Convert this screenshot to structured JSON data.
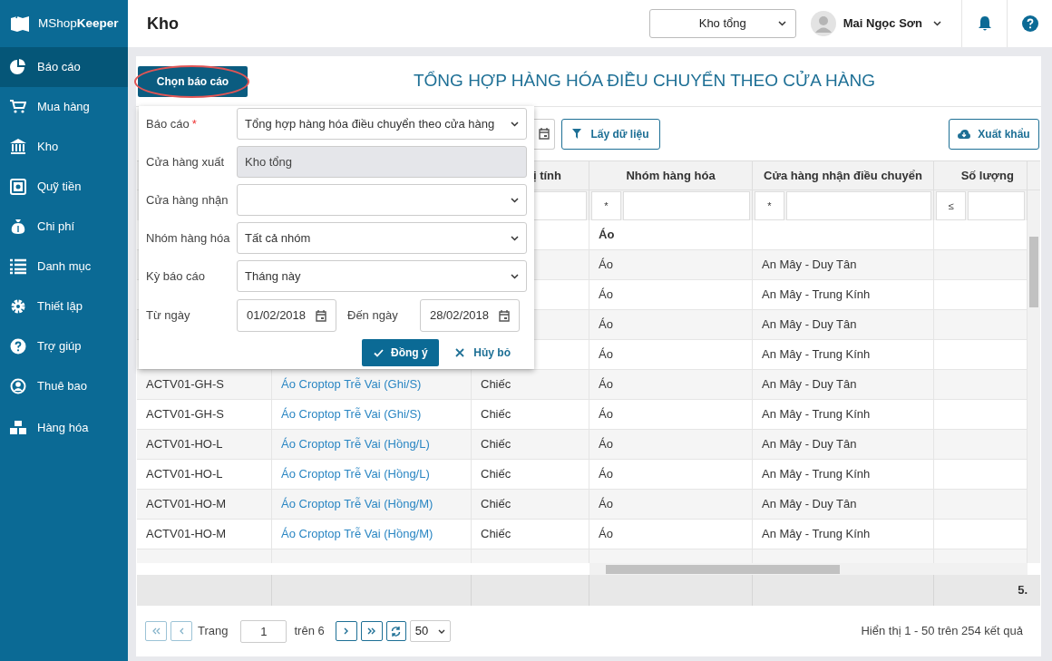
{
  "app": {
    "logo": "MShop**Keeper**"
  },
  "sidebar": {
    "items": [
      {
        "label": "Báo cáo",
        "selected": true
      },
      {
        "label": "Mua hàng",
        "selected": false
      },
      {
        "label": "Kho",
        "selected": false
      },
      {
        "label": "Quỹ tiền",
        "selected": false
      },
      {
        "label": "Chi phí",
        "selected": false
      },
      {
        "label": "Danh mục",
        "selected": false
      },
      {
        "label": "Thiết lập",
        "selected": false
      },
      {
        "label": "Trợ giúp",
        "selected": false
      },
      {
        "label": "Thuê bao",
        "selected": false
      },
      {
        "label": "Hàng hóa",
        "selected": false
      }
    ]
  },
  "header": {
    "title": "Kho",
    "store_select": "Kho tổng",
    "user": "Mai Ngọc Sơn"
  },
  "report": {
    "choose_button": "Chọn báo cáo",
    "choose_highlighted": true,
    "title": "TỔNG HỢP HÀNG HÓA ĐIỀU CHUYỂN THEO CỬA HÀNG"
  },
  "toolbar": {
    "fetch_button": "Lấy dữ liệu",
    "export_button": "Xuất khẩu"
  },
  "table": {
    "columns": [
      {},
      {},
      {
        "label": "ị tính"
      },
      {
        "label": "Nhóm hàng hóa",
        "filter_op": "*"
      },
      {
        "label": "Cửa hàng nhận điều chuyển",
        "filter_op": "*"
      },
      {
        "label": "Số lượng",
        "filter_op": "≤"
      }
    ],
    "rows": [
      {
        "kind": "group",
        "group": "Áo"
      },
      {
        "kind": "item",
        "group": "Áo",
        "store": "An Mây - Duy Tân"
      },
      {
        "kind": "item",
        "group": "Áo",
        "store": "An Mây - Trung Kính"
      },
      {
        "kind": "item",
        "group": "Áo",
        "store": "An Mây - Duy Tân"
      },
      {
        "kind": "item",
        "group": "Áo",
        "store": "An Mây - Trung Kính"
      },
      {
        "kind": "item",
        "code": "ACTV01-GH-S",
        "name": "Áo Croptop Trễ Vai (Ghi/S)",
        "unit": "Chiếc",
        "group": "Áo",
        "store": "An Mây - Duy Tân"
      },
      {
        "kind": "item",
        "code": "ACTV01-GH-S",
        "name": "Áo Croptop Trễ Vai (Ghi/S)",
        "unit": "Chiếc",
        "group": "Áo",
        "store": "An Mây - Trung Kính"
      },
      {
        "kind": "item",
        "code": "ACTV01-HO-L",
        "name": "Áo Croptop Trễ Vai (Hồng/L)",
        "unit": "Chiếc",
        "group": "Áo",
        "store": "An Mây - Duy Tân"
      },
      {
        "kind": "item",
        "code": "ACTV01-HO-L",
        "name": "Áo Croptop Trễ Vai (Hồng/L)",
        "unit": "Chiếc",
        "group": "Áo",
        "store": "An Mây - Trung Kính"
      },
      {
        "kind": "item",
        "code": "ACTV01-HO-M",
        "name": "Áo Croptop Trễ Vai (Hồng/M)",
        "unit": "Chiếc",
        "group": "Áo",
        "store": "An Mây - Duy Tân"
      },
      {
        "kind": "item",
        "code": "ACTV01-HO-M",
        "name": "Áo Croptop Trễ Vai (Hồng/M)",
        "unit": "Chiếc",
        "group": "Áo",
        "store": "An Mây - Trung Kính"
      },
      {
        "kind": "item"
      }
    ],
    "total": "5."
  },
  "pager": {
    "page_label": "Trang",
    "page": "1",
    "of": "trên 6",
    "per_page": "50",
    "summary": "Hiển thị 1 - 50 trên 254 kết quả"
  },
  "popup": {
    "fields": [
      {
        "kind": "select",
        "label": "Báo cáo",
        "required": true,
        "value": "Tổng hợp hàng hóa điều chuyển theo cửa hàng"
      },
      {
        "kind": "readonly",
        "label": "Cửa hàng xuất",
        "required": false,
        "value": "Kho tổng"
      },
      {
        "kind": "select",
        "label": "Cửa hàng nhận",
        "required": false
      },
      {
        "kind": "select",
        "label": "Nhóm hàng hóa",
        "required": false,
        "value": "Tất cả nhóm"
      },
      {
        "kind": "select",
        "label": "Kỳ báo cáo",
        "required": false,
        "value": "Tháng này"
      }
    ],
    "date_from": {
      "label": "Từ ngày",
      "value": "01/02/2018"
    },
    "date_to": {
      "label": "Đến ngày",
      "value": "28/02/2018"
    },
    "confirm": "Đồng ý",
    "cancel": "Hủy bỏ"
  }
}
